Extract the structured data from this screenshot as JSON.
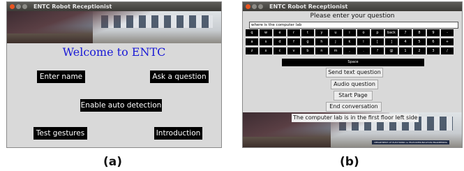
{
  "window_a": {
    "title": "ENTC Robot Receptionist",
    "welcome": "Welcome to ENTC",
    "buttons": {
      "enter_name": "Enter name",
      "ask_question": "Ask a question",
      "auto_detect": "Enable auto detection",
      "test_gestures": "Test gestures",
      "introduction": "Introduction"
    },
    "caption": "(a)"
  },
  "window_b": {
    "title": "ENTC Robot Receptionist",
    "prompt": "Please enter your question",
    "input_value": "where is the computer lab",
    "keyboard_rows": [
      [
        "q",
        "w",
        "e",
        "r",
        "t",
        "y",
        "u",
        "i",
        "o",
        "p",
        "back",
        "7",
        "8",
        "9",
        "-"
      ],
      [
        "a",
        "s",
        "d",
        "f",
        "g",
        "h",
        "j",
        "k",
        "l",
        "[",
        "]",
        "4",
        "5",
        "6",
        "+"
      ],
      [
        "z",
        "x",
        "c",
        "v",
        "b",
        "n",
        "m",
        ",",
        ".",
        "?",
        "@",
        "1",
        "2",
        "3",
        "/"
      ]
    ],
    "space_label": "Space",
    "buttons": {
      "send_text": "Send text question",
      "audio": "Audio question",
      "start_page": "Start Page",
      "end_conversation": "End conversation"
    },
    "answer": "The computer lab is in the first floor left side",
    "sign_text": "DEPARTMENT OF ELECTRONIC & TELECOMMUNICATION ENGINEERING",
    "caption": "(b)"
  }
}
